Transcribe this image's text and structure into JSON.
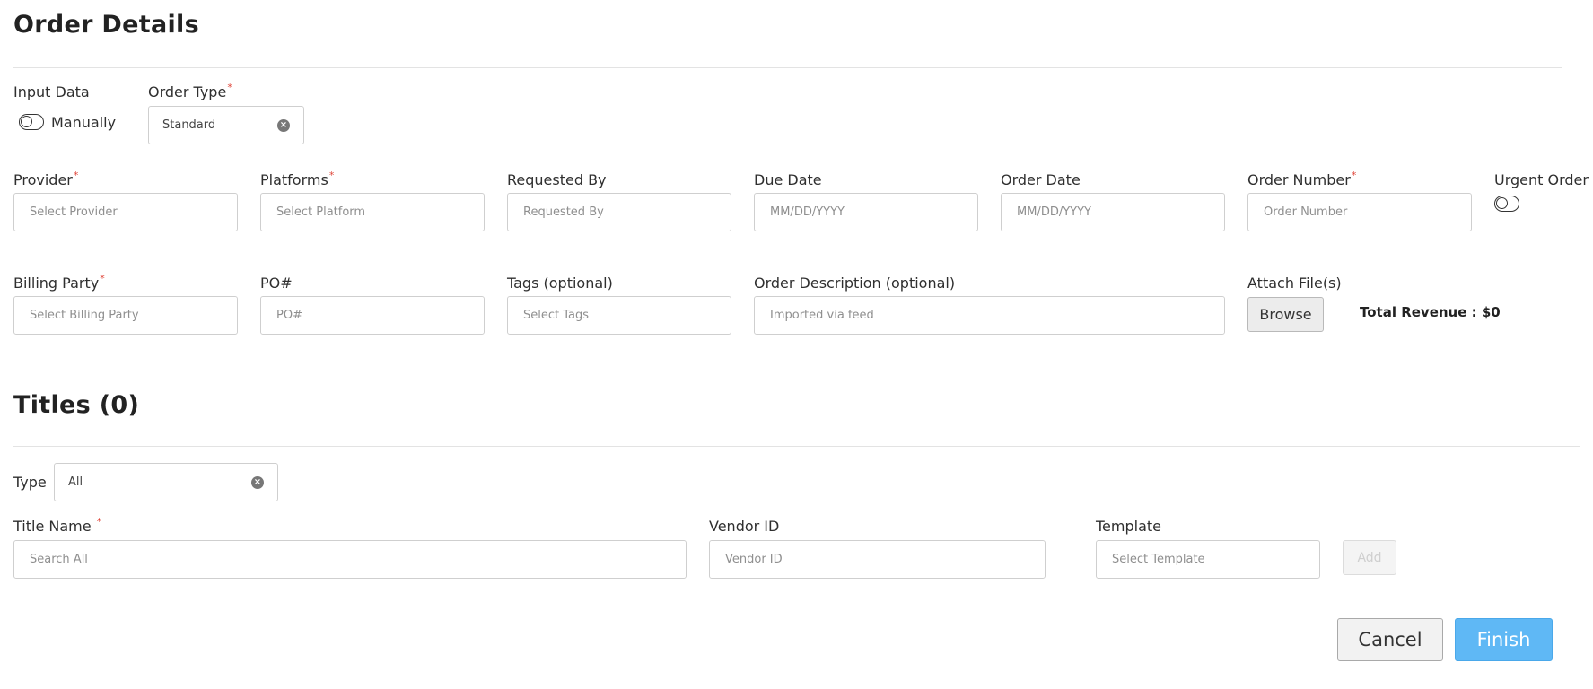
{
  "order_details": {
    "title": "Order Details",
    "input_data": {
      "label": "Input Data",
      "toggle_label": "Manually"
    },
    "order_type": {
      "label": "Order Type",
      "value": "Standard",
      "required_mark": "*"
    },
    "provider": {
      "label": "Provider",
      "placeholder": "Select Provider",
      "required_mark": "*"
    },
    "platforms": {
      "label": "Platforms",
      "placeholder": "Select Platform",
      "required_mark": "*"
    },
    "requested_by": {
      "label": "Requested By",
      "placeholder": "Requested By"
    },
    "due_date": {
      "label": "Due Date",
      "placeholder": "MM/DD/YYYY"
    },
    "order_date": {
      "label": "Order Date",
      "placeholder": "MM/DD/YYYY"
    },
    "order_number": {
      "label": "Order Number",
      "placeholder": "Order Number",
      "required_mark": "*"
    },
    "urgent_order": {
      "label": "Urgent Order"
    },
    "billing_party": {
      "label": "Billing Party",
      "placeholder": "Select Billing Party",
      "required_mark": "*"
    },
    "po_number": {
      "label": "PO#",
      "placeholder": "PO#"
    },
    "tags": {
      "label": "Tags (optional)",
      "placeholder": "Select Tags"
    },
    "order_description": {
      "label": "Order Description (optional)",
      "placeholder": "Imported via feed"
    },
    "attach_files": {
      "label": "Attach File(s)",
      "browse_label": "Browse"
    },
    "total_revenue": "Total Revenue : $0"
  },
  "titles": {
    "title": "Titles (0)",
    "type": {
      "label": "Type",
      "value": "All"
    },
    "title_name": {
      "label": "Title Name",
      "placeholder": "Search All",
      "required_mark": "*"
    },
    "vendor_id": {
      "label": "Vendor ID",
      "placeholder": "Vendor ID"
    },
    "template": {
      "label": "Template",
      "placeholder": "Select Template"
    },
    "add_label": "Add"
  },
  "footer": {
    "cancel_label": "Cancel",
    "finish_label": "Finish"
  },
  "colors": {
    "accent": "#5fb8f5",
    "required": "#e0463a"
  },
  "icons": {
    "clear": "circle-x-icon",
    "toggle": "toggle-off-icon"
  }
}
